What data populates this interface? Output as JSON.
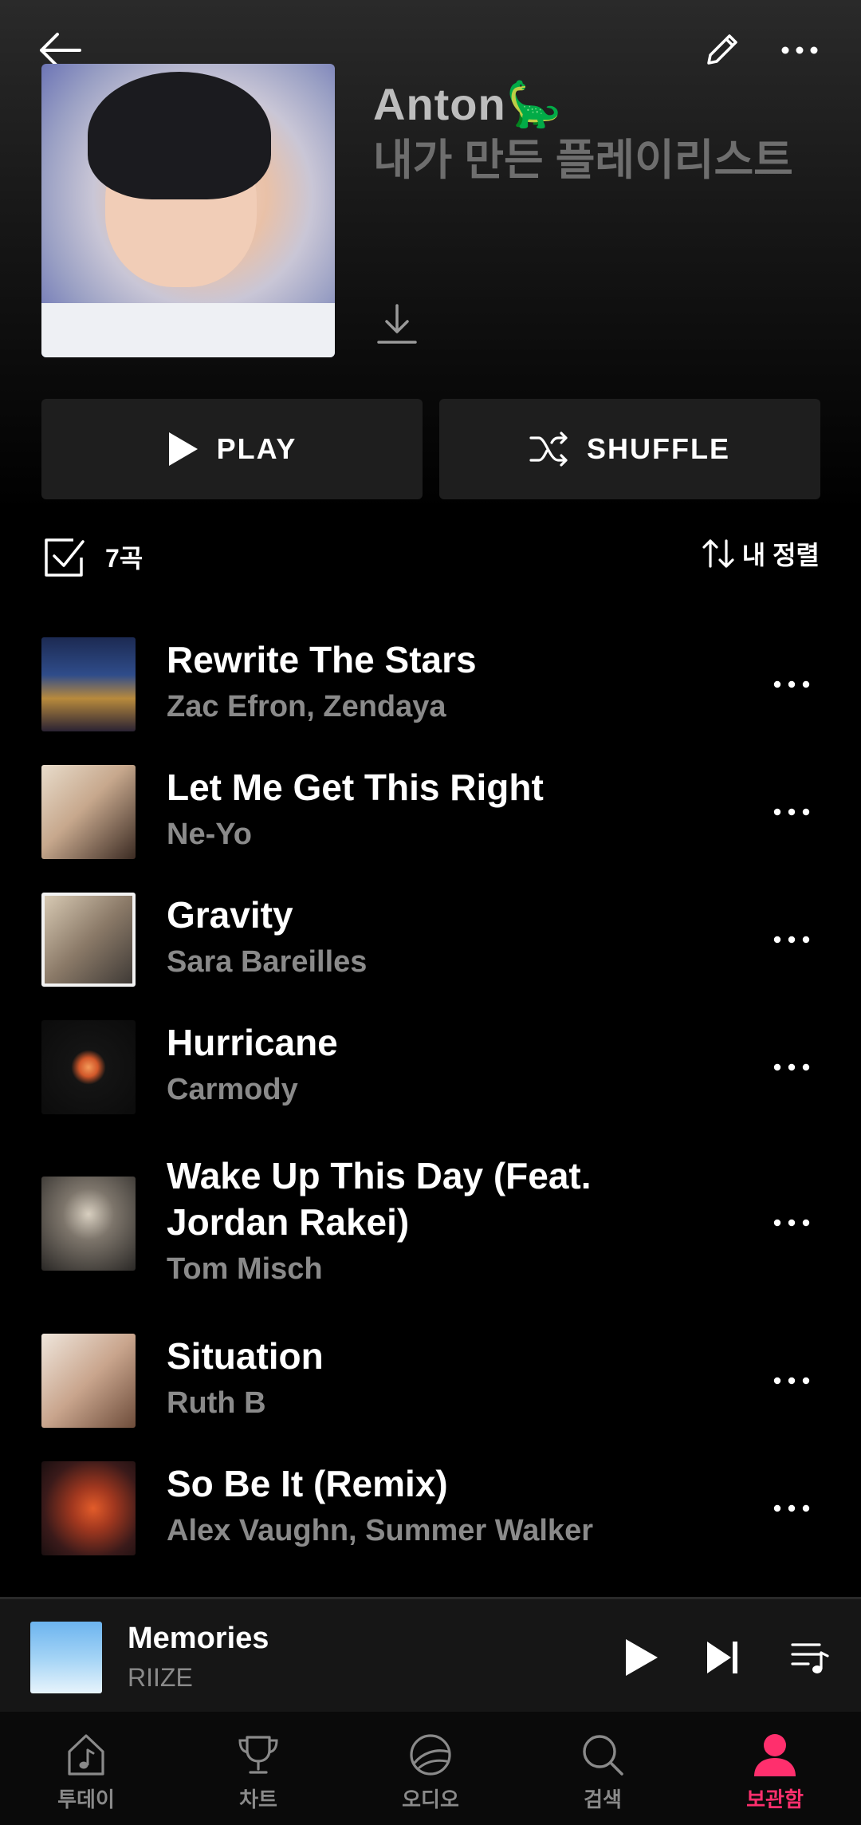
{
  "header": {
    "owner": "Anton🦕",
    "playlist_name": "내가 만든 플레이리스트"
  },
  "actions": {
    "play_label": "PLAY",
    "shuffle_label": "SHUFFLE"
  },
  "toolbar": {
    "track_count": "7곡",
    "sort_label": "내 정렬"
  },
  "tracks": [
    {
      "title": "Rewrite The Stars",
      "artist": "Zac Efron, Zendaya"
    },
    {
      "title": "Let Me Get This Right",
      "artist": "Ne-Yo"
    },
    {
      "title": "Gravity",
      "artist": "Sara Bareilles"
    },
    {
      "title": "Hurricane",
      "artist": "Carmody"
    },
    {
      "title": "Wake Up This Day (Feat. Jordan Rakei)",
      "artist": "Tom Misch"
    },
    {
      "title": "Situation",
      "artist": "Ruth B"
    },
    {
      "title": "So Be It (Remix)",
      "artist": "Alex Vaughn, Summer Walker"
    }
  ],
  "mini_player": {
    "title": "Memories",
    "artist": "RIIZE"
  },
  "bottom_nav": [
    {
      "label": "투데이",
      "icon": "music-note-icon"
    },
    {
      "label": "차트",
      "icon": "trophy-icon"
    },
    {
      "label": "오디오",
      "icon": "audio-icon"
    },
    {
      "label": "검색",
      "icon": "search-icon"
    },
    {
      "label": "보관함",
      "icon": "profile-icon",
      "active": true
    }
  ],
  "colors": {
    "accent": "#ff2f6d",
    "background": "#000000",
    "button_bg": "#1e1e1e",
    "secondary_text": "#8a8a8a"
  }
}
